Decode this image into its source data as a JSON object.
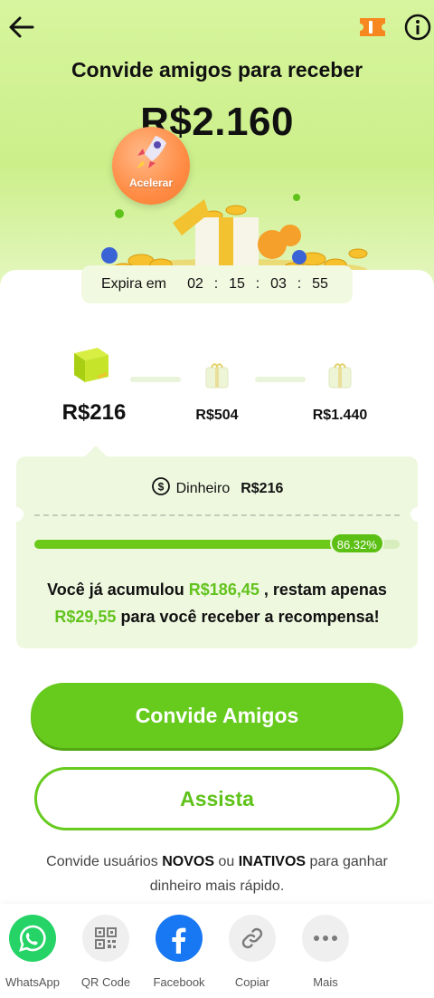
{
  "header": {
    "back_icon": "arrow-left-icon",
    "ticket_icon": "ticket-icon",
    "info_icon": "info-icon",
    "title": "Convide amigos para receber",
    "amount": "R$2.160"
  },
  "accelerate": {
    "label": "Acelerar",
    "icon": "rocket-icon"
  },
  "expiry": {
    "label": "Expira em",
    "hours": "02",
    "minutes": "15",
    "seconds": "03",
    "frames": "55",
    "separator": ":"
  },
  "steps": [
    {
      "label": "R$216",
      "state": "active"
    },
    {
      "label": "R$504",
      "state": "locked"
    },
    {
      "label": "R$1.440",
      "state": "locked"
    }
  ],
  "reward": {
    "cash_label": "Dinheiro",
    "cash_value": "R$216",
    "progress_label": "86.32%",
    "progress_fraction": 0.8632,
    "msg_part1": "Você já acumulou ",
    "accumulated": "R$186,45",
    "msg_part2": " , restam apenas",
    "remaining": "R$29,55",
    "msg_part3": " para você receber a recompensa!"
  },
  "buttons": {
    "invite": "Convide Amigos",
    "watch": "Assista"
  },
  "hint": {
    "part1": "Convide usuários ",
    "bold1": "NOVOS",
    "part2": " ou ",
    "bold2": "INATIVOS",
    "part3": " para ganhar",
    "line2": "dinheiro mais rápido."
  },
  "share": [
    {
      "label": "WhatsApp",
      "icon": "whatsapp-icon"
    },
    {
      "label": "QR Code",
      "icon": "qr-code-icon"
    },
    {
      "label": "Facebook",
      "icon": "facebook-icon"
    },
    {
      "label": "Copiar",
      "icon": "link-icon"
    },
    {
      "label": "Mais",
      "icon": "more-icon"
    }
  ],
  "colors": {
    "accent_green": "#67cb1e",
    "highlight_green": "#62c31d",
    "accelerate_orange": "#ff8c45",
    "whatsapp": "#25d366",
    "facebook": "#1877f2"
  }
}
